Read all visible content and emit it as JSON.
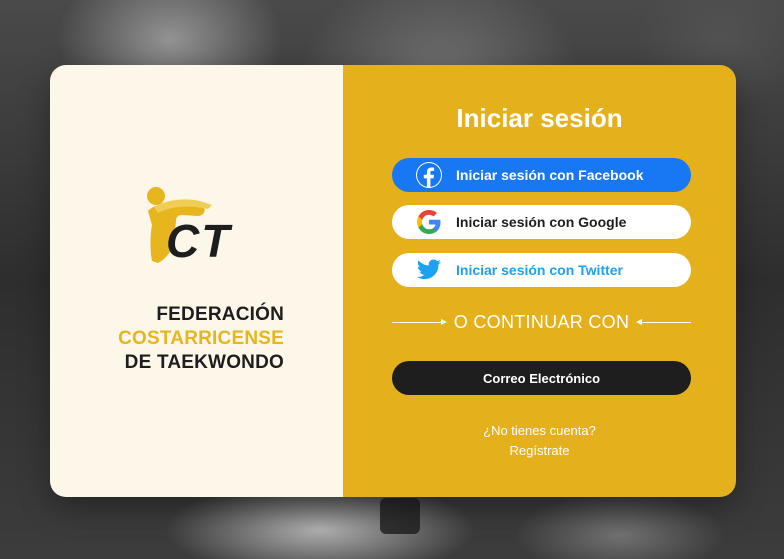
{
  "brand": {
    "logo_text": "CT",
    "org_line1": "FEDERACIÓN",
    "org_line2": "COSTARRICENSE",
    "org_line3": "DE TAEKWONDO",
    "colors": {
      "gold": "#e7b51e",
      "dark": "#1e1e1e",
      "panel_light": "#fdf7ea"
    }
  },
  "login": {
    "title": "Iniciar sesión",
    "facebook_label": "Iniciar sesión con Facebook",
    "google_label": "Iniciar sesión con Google",
    "twitter_label": "Iniciar sesión con Twitter",
    "divider_text": "O CONTINUAR CON",
    "email_label": "Correo Electrónico",
    "no_account_text": "¿No tienes cuenta?",
    "register_link": "Regístrate",
    "icons": [
      "facebook-icon",
      "google-icon",
      "twitter-icon"
    ],
    "colors": {
      "panel": "#e4b11c",
      "facebook": "#1877f2",
      "twitter": "#1da1f2",
      "email_button": "#1e1e1e"
    }
  }
}
